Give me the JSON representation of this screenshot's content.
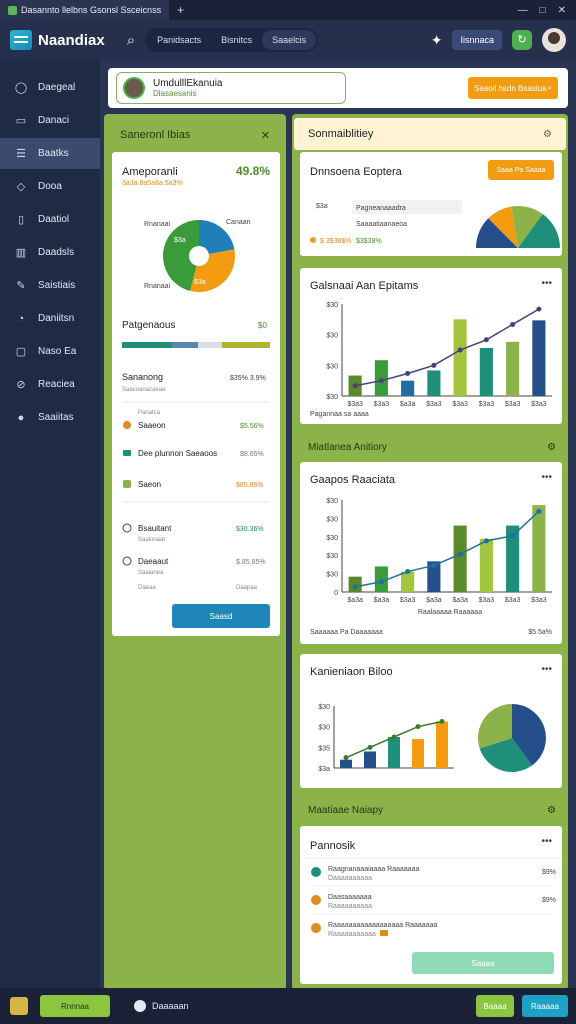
{
  "titlebar": {
    "tab_label": "Dasannto llelbns Gsonsl Ssceicnss",
    "plus": "+",
    "controls": [
      "—",
      "□",
      "✕"
    ]
  },
  "header": {
    "app_name": "Naandiax",
    "pills": [
      "Panidsacts",
      "Bisnitcs",
      "Saaelcis"
    ],
    "button": "Iisnnaca"
  },
  "sidebar": {
    "items": [
      {
        "label": "Daegeal",
        "icon": "circle-icon"
      },
      {
        "label": "Danaci",
        "icon": "folder-icon"
      },
      {
        "label": "Baatks",
        "icon": "list-icon",
        "active": true
      },
      {
        "label": "Dooa",
        "icon": "tag-icon"
      },
      {
        "label": "Daatiol",
        "icon": "file-icon"
      },
      {
        "label": "Daadsls",
        "icon": "book-icon"
      },
      {
        "label": "Saistiais",
        "icon": "pen-icon"
      },
      {
        "label": "Daniitsn",
        "icon": "clock-icon"
      },
      {
        "label": "Naso Ea",
        "icon": "box-icon"
      },
      {
        "label": "Reaciea",
        "icon": "link-icon"
      },
      {
        "label": "Saaiitas",
        "icon": "info-icon"
      }
    ]
  },
  "topcard": {
    "user_name": "UmdulllEkanuia",
    "user_sub": "Dlasaesanis",
    "search_label": "Saaoil hsdn Bsasiua"
  },
  "leftcol": {
    "title": "Saneronl Ibias",
    "close": "✕",
    "card": {
      "title": "Ameporanli",
      "value": "49.8%",
      "sub": "3a3a 8a5a8a.5a3%",
      "pie_labels": [
        "Rnanaai",
        "Canaan",
        "Rnanaai"
      ],
      "pie_vals": [
        "$3a",
        "$3a"
      ],
      "progress_label": "Patgenaous",
      "progress_value": "$0",
      "list_title": "Sananong",
      "list_value": "$35% 3.9%",
      "list_sub": "Saacoanacaeaa",
      "rows": [
        {
          "label": "Panatca",
          "value": ""
        },
        {
          "label": "Saaeon",
          "value": "$5.56%"
        },
        {
          "label": "Dee plunnon Saeaoos",
          "value": "$8.65%"
        },
        {
          "label": "Saeon",
          "value": "$85.86%"
        },
        {
          "label": "Bsauitant",
          "value": "$30.36%"
        },
        {
          "label": "Daeaaut",
          "value": "$.85.85%"
        }
      ],
      "row_subs": [
        "Saaionaat",
        "Saaianea",
        "Daeaa"
      ],
      "foot_value": "Daapaa",
      "button": "Saasd"
    }
  },
  "rightcol": {
    "strip_title": "Sonmaiblitiey",
    "card1": {
      "title": "Dnnsoena Eoptera",
      "button": "Saaa Pa Saaaa",
      "small1": "$3a",
      "small1_label": "Pagneanaaadra",
      "small2": "Saaaatiaanaeoa",
      "stat_a": "$ 3$38$%",
      "stat_b": "$3$38%"
    },
    "chart1": {
      "title": "Galsnaai Aan Epitams",
      "ylabels": [
        "$30",
        "$30",
        "$30",
        "$30"
      ],
      "xlabels": [
        "$3a3",
        "$3a3",
        "$a3a",
        "$3a3",
        "$3a3",
        "$3a3",
        "$3a3",
        "$3a3"
      ],
      "foot": "Pagannaa sa aaaa"
    },
    "section1": "Miatlanea Anitiory",
    "chart2": {
      "title": "Gaapos Raaciata",
      "ylabels": [
        "$30",
        "$30",
        "$30",
        "$30",
        "$30",
        "0"
      ],
      "xlabels": [
        "$a3a",
        "$a3a",
        "$3a3",
        "$a3a",
        "$a3a",
        "$3a3",
        "$3a3",
        "$3a3"
      ],
      "xaxis_title": "Raalaaaaa Raaaaaa",
      "foot_left": "Saaaaaa Pa Daaaaaaa",
      "foot_right": "$5 5a%"
    },
    "chart3": {
      "title": "Kanieniaon Biloo",
      "ylabels": [
        "$30",
        "$30",
        "$35",
        "$3a"
      ]
    },
    "section2": "Maatiaae Naiapy",
    "card4": {
      "title": "Pannosik",
      "items": [
        {
          "label": "Raagnanaaaiaaaa Raaaaaaa",
          "sub": "Daaaaaaaaaa",
          "value": "$9%",
          "color": "#1f8f7a"
        },
        {
          "label": "Daasaaaaaaa",
          "sub": "Raaaaaaaaaa",
          "value": "$9%",
          "color": "#e08b1d"
        },
        {
          "label": "Raaaaaaaaaaaaaaaaaa Raaaaaaa",
          "sub": "Raaaaaaaaaaa",
          "value": "",
          "color": "#e08b1d"
        }
      ],
      "button": "Saaaa"
    }
  },
  "bottombar": {
    "green_label": "Rnnnaa",
    "item_label": "Daaaaan",
    "btn1": "Baaaa",
    "btn2": "Raaaaa"
  },
  "chart_data": [
    {
      "type": "pie",
      "categories": [
        "Teal",
        "Orange",
        "Green"
      ],
      "values": [
        22,
        32,
        46
      ],
      "colors": [
        "#1f7fb6",
        "#f39c12",
        "#3a9b3a"
      ],
      "title": "Ameporanli"
    },
    {
      "type": "bar",
      "title": "Galsnaai Aan Epitams",
      "categories": [
        "1",
        "2",
        "3",
        "4",
        "5",
        "6",
        "7",
        "8"
      ],
      "values": [
        20,
        35,
        15,
        25,
        75,
        47,
        53,
        74
      ],
      "line": [
        10,
        15,
        22,
        30,
        45,
        55,
        70,
        85
      ],
      "ylim": [
        0,
        90
      ]
    },
    {
      "type": "bar",
      "title": "Gaapos Raaciata",
      "categories": [
        "1",
        "2",
        "3",
        "4",
        "5",
        "6",
        "7",
        "8"
      ],
      "values": [
        15,
        25,
        20,
        30,
        65,
        52,
        65,
        85
      ],
      "line": [
        5,
        10,
        20,
        26,
        37,
        50,
        55,
        79
      ],
      "ylim": [
        0,
        90
      ]
    },
    {
      "type": "bar",
      "title": "Kanieniaon Biloo",
      "categories": [
        "1",
        "2",
        "3",
        "4",
        "5"
      ],
      "values": [
        8,
        16,
        30,
        28,
        45
      ],
      "line": [
        10,
        20,
        30,
        40,
        45
      ],
      "ylim": [
        0,
        60
      ]
    },
    {
      "type": "pie",
      "title": "Kanieniaon Biloo (pie)",
      "categories": [
        "Blue",
        "Teal",
        "Green"
      ],
      "values": [
        40,
        30,
        30
      ],
      "colors": [
        "#244f8a",
        "#1f8f7a",
        "#8cb24a"
      ]
    }
  ]
}
